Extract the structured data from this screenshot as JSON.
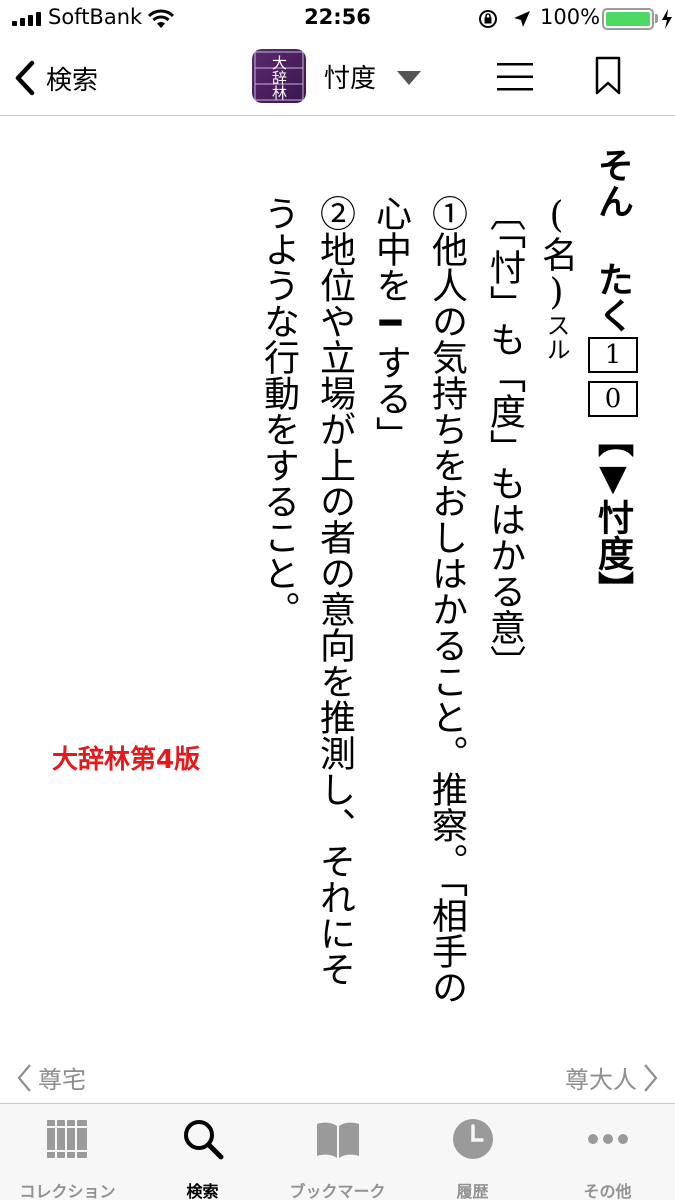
{
  "status_bar": {
    "carrier": "SoftBank",
    "time": "22:56",
    "battery_percent": "100%",
    "battery_level": 1.0,
    "icons": [
      "signal-icon",
      "wifi-icon",
      "orientation-lock-icon",
      "location-icon",
      "battery-icon",
      "charging-icon"
    ]
  },
  "nav": {
    "back_label": "検索",
    "app_icon_text": "大辞林",
    "title": "忖度"
  },
  "entry": {
    "headword": "そん たく",
    "accent_1": "1",
    "accent_2": "0",
    "kanji": "【▼忖度】",
    "pos": "(名)",
    "pos_suffix": "スル",
    "etymology": "〔「忖」も「度」もはかる意〕",
    "sense1_line1": "①他人の気持ちをおしはかること。推察。「相手の",
    "sense1_line2": "心中を━する」",
    "sense2_line1": "②地位や立場が上の者の意向を推測し、それにそ",
    "sense2_line2": "うような行動をすること。"
  },
  "source_label": "大辞林第4版",
  "pager": {
    "prev": "尊宅",
    "next": "尊大人"
  },
  "tabs": [
    {
      "label": "コレクション",
      "icon": "books-icon",
      "active": false
    },
    {
      "label": "検索",
      "icon": "search-icon",
      "active": true
    },
    {
      "label": "ブックマーク",
      "icon": "open-book-icon",
      "active": false
    },
    {
      "label": "履歴",
      "icon": "clock-icon",
      "active": false
    },
    {
      "label": "その他",
      "icon": "more-icon",
      "active": false
    }
  ],
  "colors": {
    "accent_red": "#e5191c",
    "battery_green": "#4cd964",
    "inactive_gray": "#929292"
  }
}
